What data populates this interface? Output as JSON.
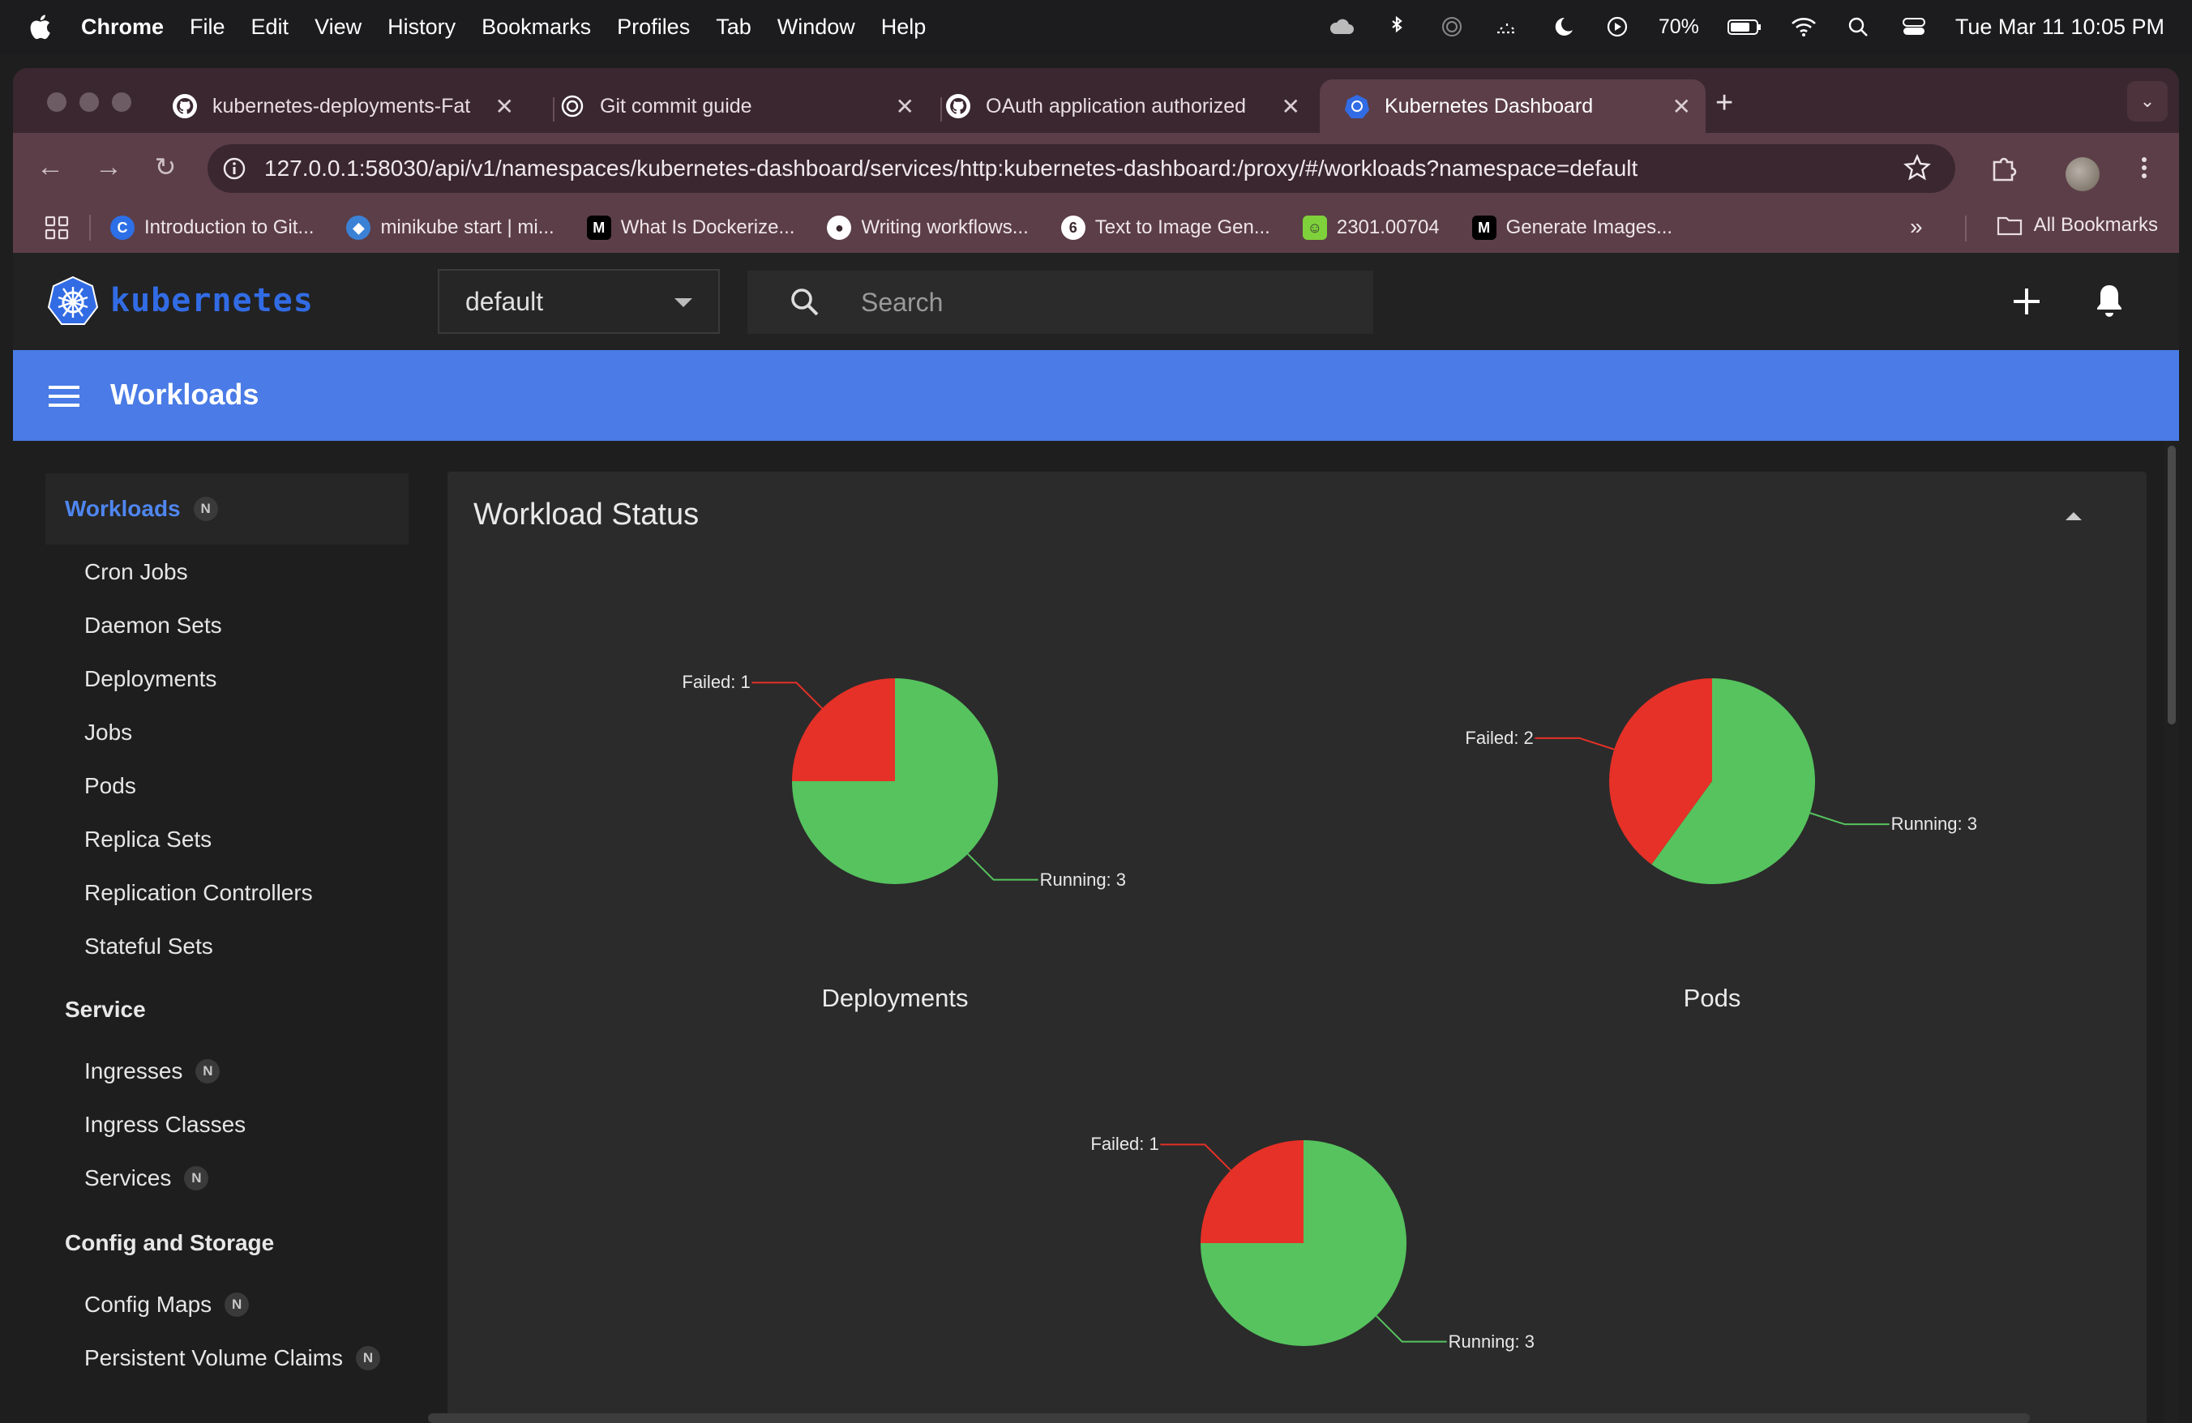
{
  "menubar": {
    "app": "Chrome",
    "items": [
      "File",
      "Edit",
      "View",
      "History",
      "Bookmarks",
      "Profiles",
      "Tab",
      "Window",
      "Help"
    ],
    "battery": "70%",
    "datetime": "Tue Mar 11  10:05 PM"
  },
  "tabs": [
    {
      "title": "kubernetes-deployments-Fat",
      "icon": "github-icon",
      "active": false
    },
    {
      "title": "Git commit guide",
      "icon": "openai-icon",
      "active": false
    },
    {
      "title": "OAuth application authorized",
      "icon": "github-icon",
      "active": false
    },
    {
      "title": "Kubernetes Dashboard",
      "icon": "kubernetes-icon",
      "active": true
    }
  ],
  "omnibox": {
    "url": "127.0.0.1:58030/api/v1/namespaces/kubernetes-dashboard/services/http:kubernetes-dashboard:/proxy/#/workloads?namespace=default"
  },
  "bookmarks": [
    {
      "label": "Introduction to Git...",
      "icon": "c",
      "color": "#2d6fe6"
    },
    {
      "label": "minikube start | mi...",
      "icon": "minikube",
      "color": "#3b82d6"
    },
    {
      "label": "What Is Dockerize...",
      "icon": "M",
      "color": "#000000"
    },
    {
      "label": "Writing workflows...",
      "icon": "github",
      "color": "#ffffff"
    },
    {
      "label": "Text to Image Gen...",
      "icon": "6",
      "color": "#ffffff"
    },
    {
      "label": "2301.00704",
      "icon": "smiley",
      "color": "#7fd13b"
    },
    {
      "label": "Generate Images...",
      "icon": "M",
      "color": "#000000"
    }
  ],
  "all_bookmarks": "All Bookmarks",
  "app": {
    "logo_text": "kubernetes",
    "namespace": "default",
    "search_placeholder": "Search",
    "page_title": "Workloads"
  },
  "sidebar": {
    "sections": [
      {
        "title": "Workloads",
        "badge": "N",
        "active": true,
        "items": [
          {
            "label": "Cron Jobs"
          },
          {
            "label": "Daemon Sets"
          },
          {
            "label": "Deployments"
          },
          {
            "label": "Jobs"
          },
          {
            "label": "Pods"
          },
          {
            "label": "Replica Sets"
          },
          {
            "label": "Replication Controllers"
          },
          {
            "label": "Stateful Sets"
          }
        ]
      },
      {
        "title": "Service",
        "badge": "",
        "active": false,
        "items": [
          {
            "label": "Ingresses",
            "badge": "N"
          },
          {
            "label": "Ingress Classes"
          },
          {
            "label": "Services",
            "badge": "N"
          }
        ]
      },
      {
        "title": "Config and Storage",
        "badge": "",
        "active": false,
        "items": [
          {
            "label": "Config Maps",
            "badge": "N"
          },
          {
            "label": "Persistent Volume Claims",
            "badge": "N"
          }
        ]
      }
    ]
  },
  "card": {
    "title": "Workload Status"
  },
  "chart_data": [
    {
      "type": "pie",
      "title": "Deployments",
      "slices": [
        {
          "label": "Failed: 1",
          "value": 1,
          "color": "#e53127"
        },
        {
          "label": "Running: 3",
          "value": 3,
          "color": "#56c35e"
        }
      ]
    },
    {
      "type": "pie",
      "title": "Pods",
      "slices": [
        {
          "label": "Failed: 2",
          "value": 2,
          "color": "#e53127"
        },
        {
          "label": "Running: 3",
          "value": 3,
          "color": "#56c35e"
        }
      ]
    },
    {
      "type": "pie",
      "title": "",
      "slices": [
        {
          "label": "Failed: 1",
          "value": 1,
          "color": "#e53127"
        },
        {
          "label": "Running: 3",
          "value": 3,
          "color": "#56c35e"
        }
      ]
    }
  ]
}
